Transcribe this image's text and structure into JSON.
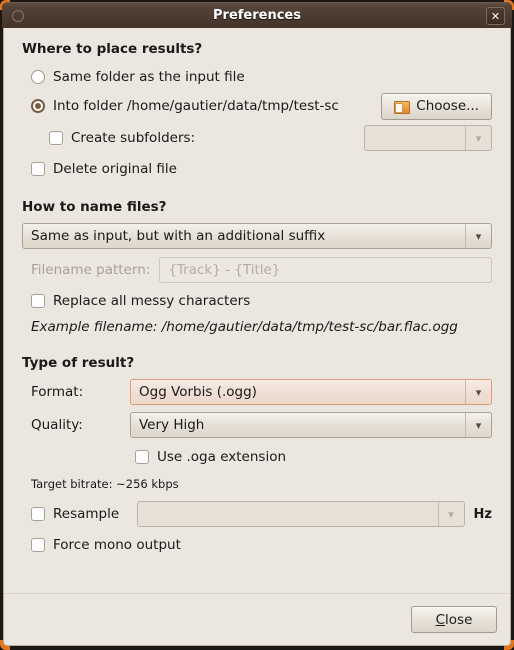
{
  "window": {
    "title": "Preferences",
    "close_icon": "close-icon",
    "menu_icon": "window-menu-icon",
    "accent_color": "#e4761b",
    "titlebar_color": "#4a3a30",
    "body_color": "#ebe6df"
  },
  "sections": {
    "where": {
      "heading": "Where to place results?",
      "option_same_folder": "Same folder as the input file",
      "option_into_folder": "Into folder /home/gautier/data/tmp/test-sc",
      "choose_button": "Choose...",
      "choose_icon": "folder-icon",
      "create_subfolders": "Create subfolders:",
      "subfolders_value": "",
      "delete_original": "Delete original file"
    },
    "naming": {
      "heading": "How to name files?",
      "scheme_value": "Same as input, but with an additional suffix",
      "pattern_label": "Filename pattern:",
      "pattern_placeholder": "{Track} - {Title}",
      "pattern_value": "",
      "replace_messy": "Replace all messy characters",
      "example": "Example filename: /home/gautier/data/tmp/test-sc/bar.flac.ogg"
    },
    "result": {
      "heading": "Type of result?",
      "format_label": "Format:",
      "format_value": "Ogg Vorbis (.ogg)",
      "quality_label": "Quality:",
      "quality_value": "Very High",
      "oga_extension": "Use .oga extension",
      "target_bitrate": "Target bitrate: ~256 kbps",
      "resample": "Resample",
      "resample_value": "",
      "hz_label": "Hz",
      "force_mono": "Force mono output",
      "focus_border_color": "#e09a72"
    }
  },
  "footer": {
    "close_mnemonic": "C",
    "close_rest": "lose"
  },
  "icons": {
    "chevron_down": "▾",
    "close_x": "✕"
  }
}
